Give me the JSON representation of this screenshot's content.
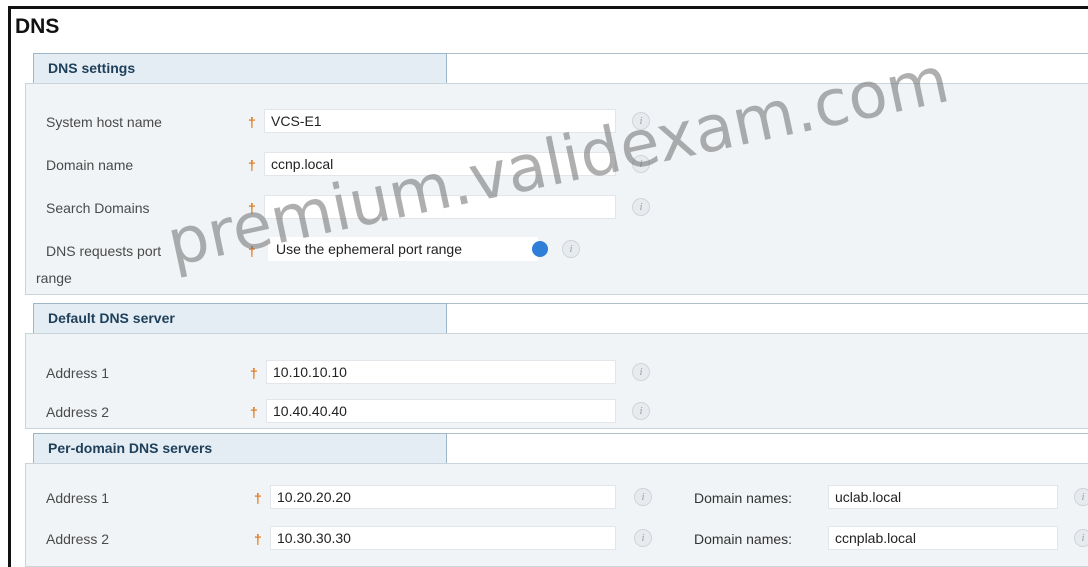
{
  "page": {
    "title": "DNS"
  },
  "dns_settings": {
    "header": "DNS settings",
    "fields": [
      {
        "label": "System host name",
        "value": "VCS-E1"
      },
      {
        "label": "Domain name",
        "value": "ccnp.local"
      },
      {
        "label": "Search Domains",
        "value": ""
      }
    ],
    "port_range": {
      "label_line1": "DNS requests port",
      "label_line2": "range",
      "selected": "Use the ephemeral port range"
    }
  },
  "default_dns": {
    "header": "Default DNS server",
    "fields": [
      {
        "label": "Address 1",
        "value": "10.10.10.10"
      },
      {
        "label": "Address 2",
        "value": "10.40.40.40"
      }
    ]
  },
  "per_domain_dns": {
    "header": "Per-domain DNS servers",
    "rows": [
      {
        "label": "Address 1",
        "value": "10.20.20.20",
        "domain_label": "Domain names:",
        "domain_value": "uclab.local"
      },
      {
        "label": "Address 2",
        "value": "10.30.30.30",
        "domain_label": "Domain names:",
        "domain_value": "ccnplab.local"
      }
    ]
  },
  "required_marker": "†",
  "info_glyph": "i",
  "watermark": "premium.validexam.com",
  "colors": {
    "section_bg": "#f1f4f6",
    "header_bg": "#e4edf3",
    "header_text": "#1e3f5a",
    "required": "#e07a1c"
  }
}
